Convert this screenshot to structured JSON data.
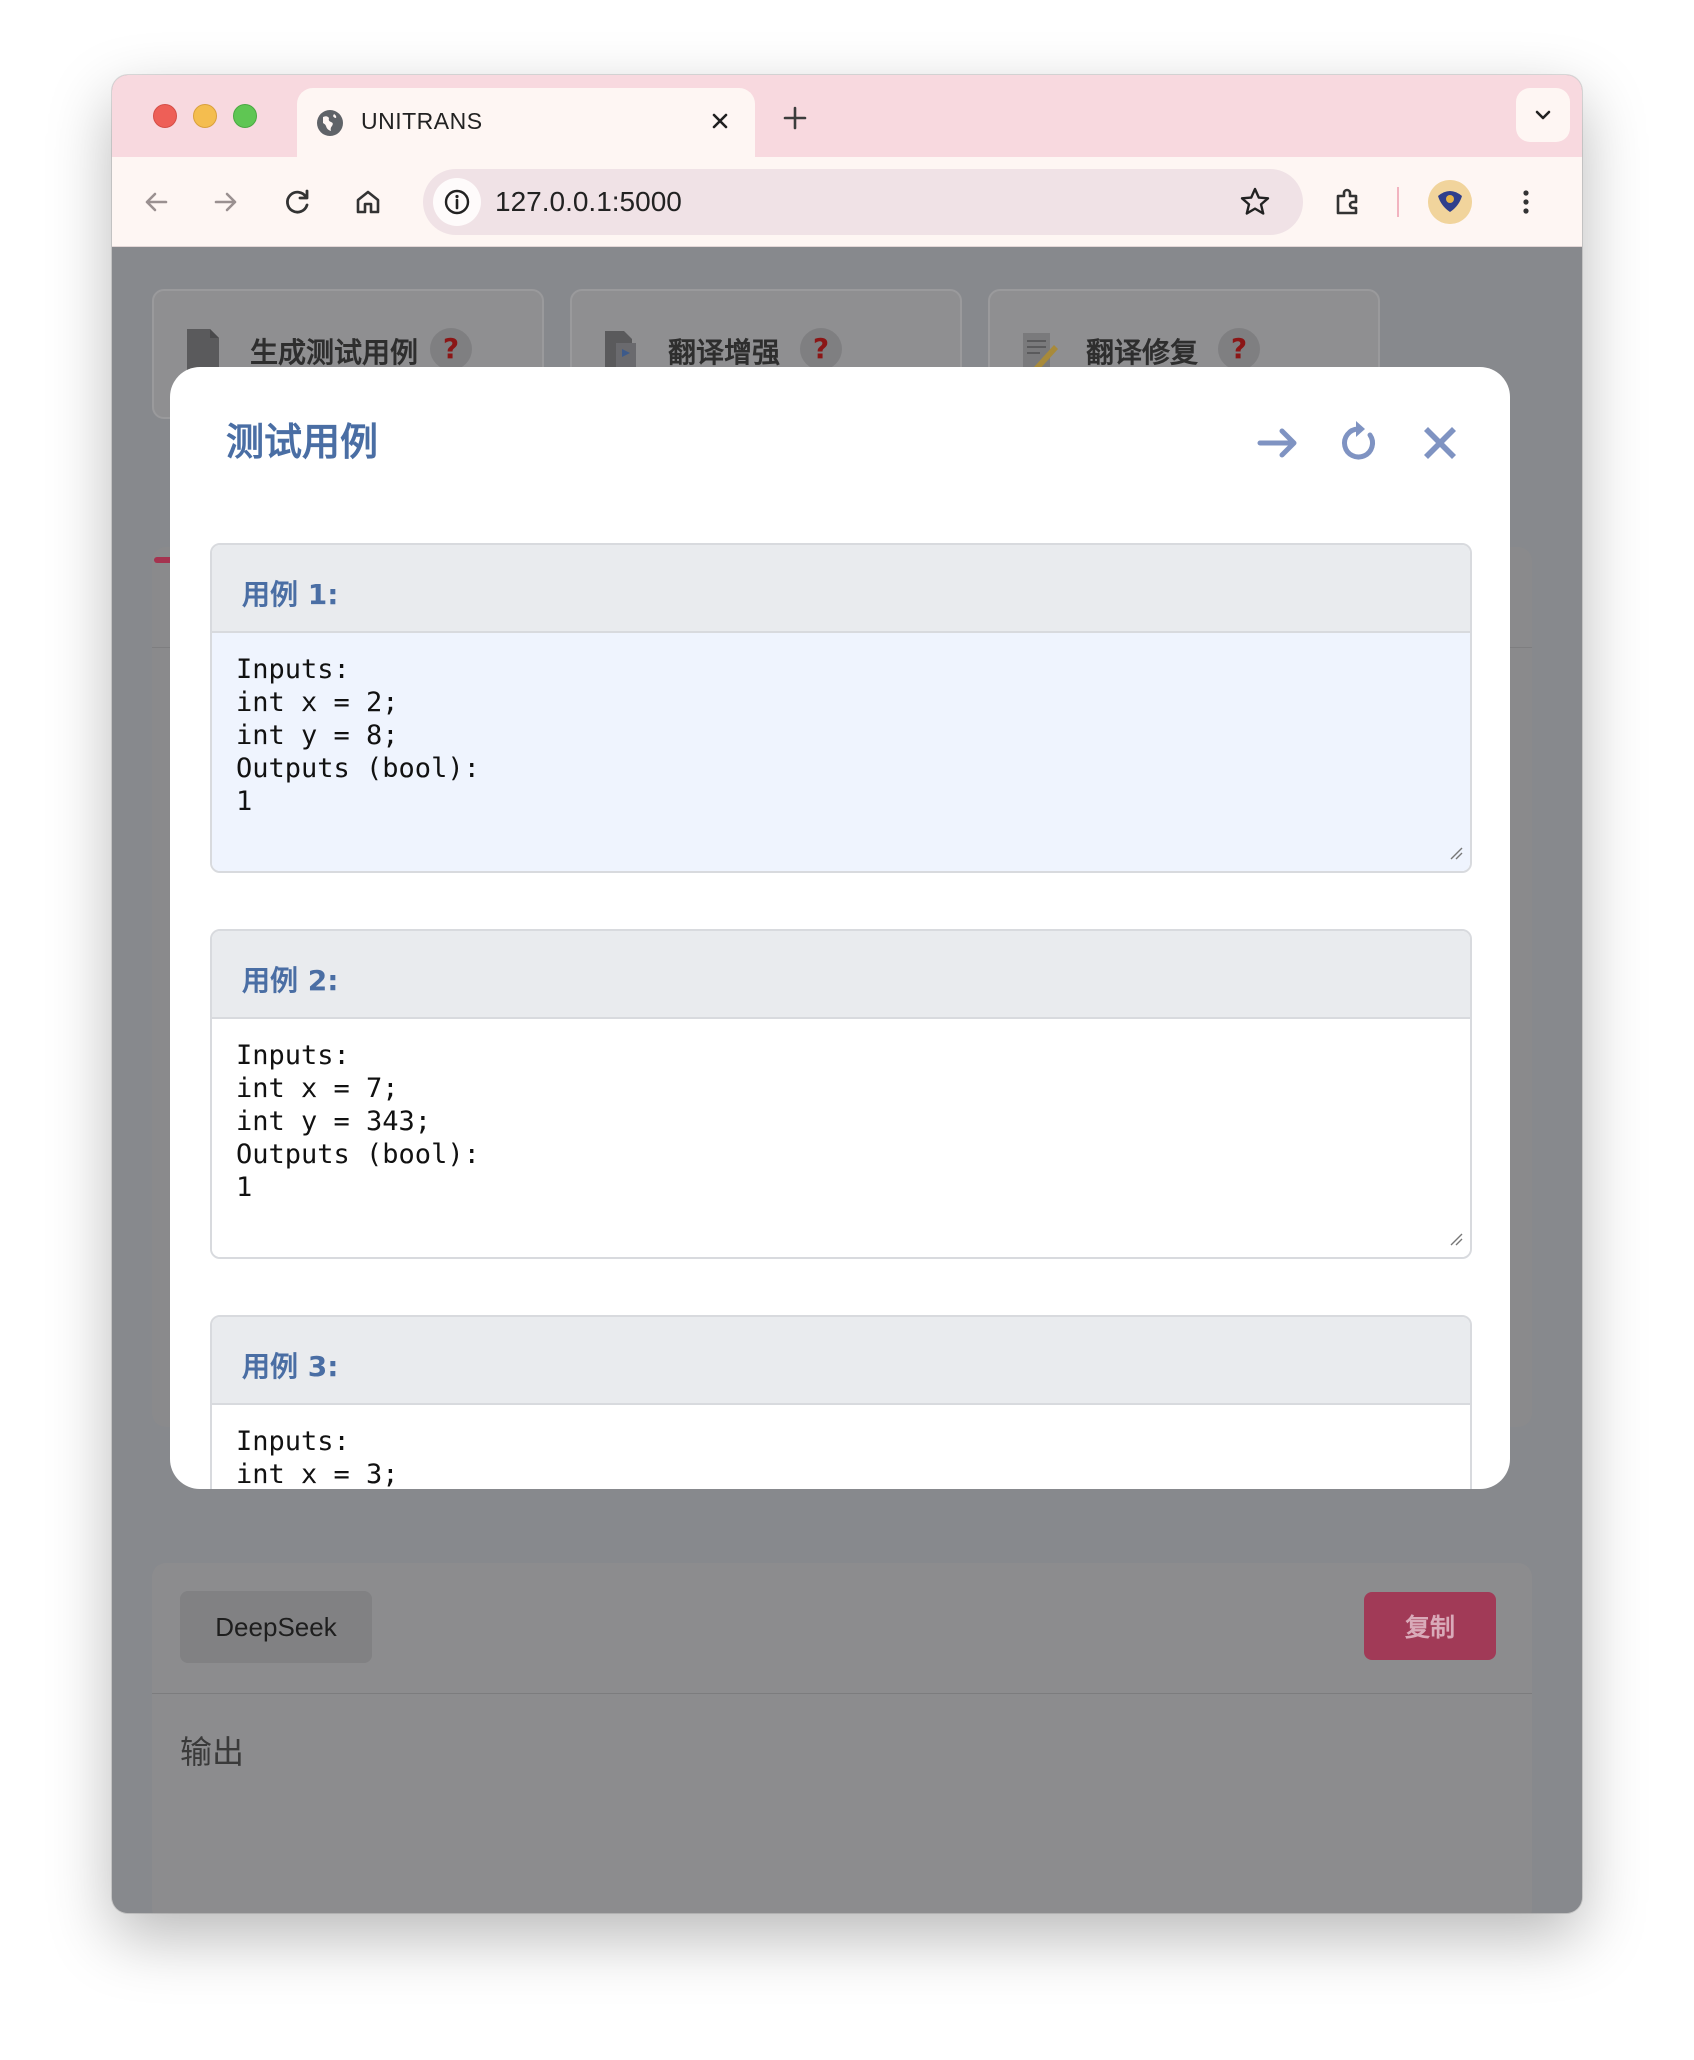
{
  "browser": {
    "tab_title": "UNITRANS",
    "url": "127.0.0.1:5000"
  },
  "page": {
    "tabs": [
      {
        "label": "生成测试用例",
        "help": "?"
      },
      {
        "label": "翻译增强",
        "help": "?"
      },
      {
        "label": "翻译修复",
        "help": "?"
      }
    ],
    "model_button": "DeepSeek",
    "copy_button": "复制",
    "output_label": "输出"
  },
  "modal": {
    "title": "测试用例",
    "cases": [
      {
        "label": "用例 1:",
        "content": "Inputs:\nint x = 2;\nint y = 8;\nOutputs (bool):\n1"
      },
      {
        "label": "用例 2:",
        "content": "Inputs:\nint x = 7;\nint y = 343;\nOutputs (bool):\n1"
      },
      {
        "label": "用例 3:",
        "content": "Inputs:\nint x = 3;"
      }
    ]
  },
  "colors": {
    "accent": "#4a6ea4",
    "copy_button": "#a13a57",
    "tabstrip": "#f8d9df"
  },
  "icons": [
    "globe-icon",
    "close-icon",
    "plus-icon",
    "chevron-down-icon",
    "back-arrow-icon",
    "forward-arrow-icon",
    "reload-icon",
    "home-icon",
    "info-icon",
    "star-icon",
    "extensions-icon",
    "kebab-menu-icon",
    "arrow-right-icon",
    "refresh-icon",
    "x-icon"
  ]
}
